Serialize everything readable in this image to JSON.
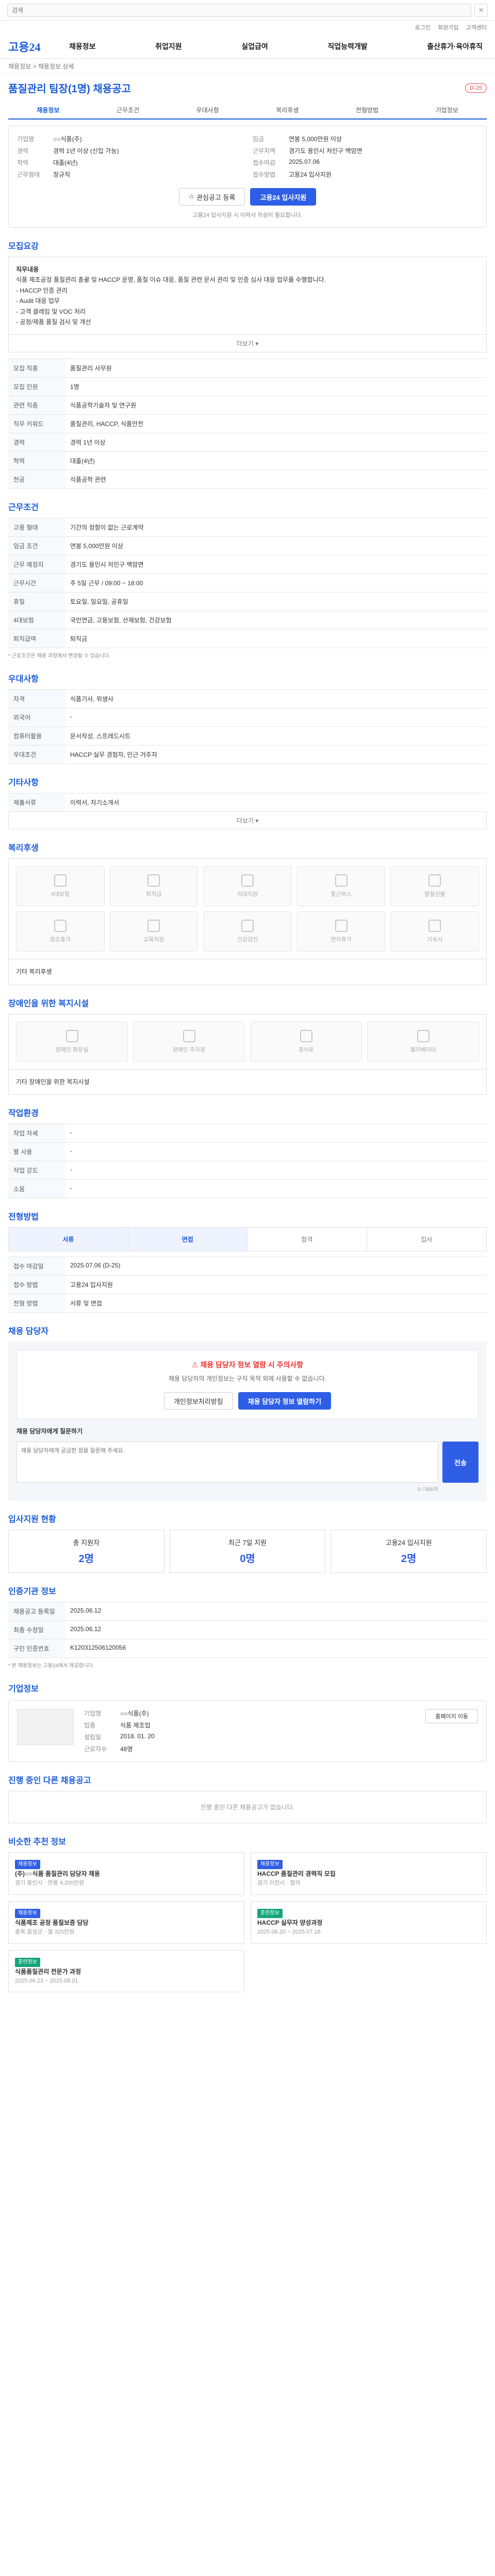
{
  "topbar": {
    "search_placeholder": "검색",
    "close_label": "✕"
  },
  "util": [
    "로그인",
    "회원가입",
    "고객센터"
  ],
  "logo": "고용24",
  "gnb": [
    "채용정보",
    "취업지원",
    "실업급여",
    "직업능력개발",
    "출산휴가·육아휴직"
  ],
  "breadcrumb": "채용정보 > 채용정보 상세",
  "title": {
    "text": "품질관리 팀장(1명) 채용공고",
    "pill": "D-25"
  },
  "tabs": [
    "채용정보",
    "근무조건",
    "우대사항",
    "복리후생",
    "전형방법",
    "기업정보"
  ],
  "summary": {
    "company_label": "기업명",
    "company": "○○식품(주)",
    "career_label": "경력",
    "career": "경력 1년 이상 (신입 가능)",
    "edu_label": "학력",
    "edu": "대졸(4년)",
    "type_label": "근무형태",
    "type": "정규직",
    "salary_label": "임금",
    "salary": "연봉 5,000만원 이상",
    "place_label": "근무지역",
    "place": "경기도 용인시 처인구 백암면",
    "apply_label": "접수마감",
    "apply": "2025.07.06",
    "method_label": "접수방법",
    "method": "고용24 입사지원",
    "bookmark_btn": "관심공고 등록",
    "apply_btn": "고용24 입사지원",
    "note": "고용24 입사지원 시 이력서 작성이 필요합니다."
  },
  "job": {
    "heading": "모집요강",
    "desc_title": "직무내용",
    "desc": "식품 제조공정 품질관리 총괄 및 HACCP 운영, 품질 이슈 대응, 품질 관련 문서 관리 및 인증 심사 대응 업무를 수행합니다.",
    "duty_lines": [
      "- HACCP 인증 관리",
      "- Audit 대응 업무",
      "- 고객 클레임 및 VOC 처리",
      "- 공정/제품 품질 검사 및 개선"
    ],
    "more": "더보기 ▾",
    "rows": [
      {
        "k": "모집 직종",
        "v": "품질관리 사무원"
      },
      {
        "k": "모집 인원",
        "v": "1명"
      },
      {
        "k": "관련 직종",
        "v": "식품공학기술자 및 연구원"
      },
      {
        "k": "직무 키워드",
        "v": "품질관리, HACCP, 식품안전"
      },
      {
        "k": "경력",
        "v": "경력 1년 이상"
      },
      {
        "k": "학력",
        "v": "대졸(4년)"
      },
      {
        "k": "전공",
        "v": "식품공학 관련"
      }
    ]
  },
  "work": {
    "heading": "근무조건",
    "rows": [
      {
        "k": "고용 형태",
        "v": "기간의 정함이 없는 근로계약"
      },
      {
        "k": "임금 조건",
        "v": "연봉 5,000만원 이상"
      },
      {
        "k": "근무 예정지",
        "v": "경기도 용인시 처인구 백암면"
      },
      {
        "k": "근무시간",
        "v": "주 5일 근무 / 09:00 ~ 18:00"
      },
      {
        "k": "휴일",
        "v": "토요일, 일요일, 공휴일"
      },
      {
        "k": "4대보험",
        "v": "국민연금, 고용보험, 산재보험, 건강보험"
      },
      {
        "k": "퇴직급여",
        "v": "퇴직금"
      }
    ],
    "note": "* 근로조건은 채용 과정에서 변경될 수 있습니다."
  },
  "pref": {
    "heading": "우대사항",
    "rows": [
      {
        "k": "자격",
        "v": "식품기사, 위생사"
      },
      {
        "k": "외국어",
        "v": "-"
      },
      {
        "k": "컴퓨터활용",
        "v": "문서작성, 스프레드시트"
      },
      {
        "k": "우대조건",
        "v": "HACCP 실무 경험자, 인근 거주자"
      }
    ]
  },
  "other": {
    "heading": "기타사항",
    "rows": [
      {
        "k": "제출서류",
        "v": "이력서, 자기소개서"
      }
    ],
    "more": "더보기 ▾"
  },
  "benefits": {
    "heading": "복리후생",
    "items": [
      "4대보험",
      "퇴직금",
      "식대지원",
      "통근버스",
      "명절선물",
      "경조휴가",
      "교육지원",
      "건강검진",
      "연차휴가",
      "기숙사"
    ],
    "more_label": "기타 복리후생"
  },
  "disability": {
    "heading": "장애인을 위한 복지시설",
    "items": [
      "장애인 화장실",
      "장애인 주차장",
      "경사로",
      "엘리베이터"
    ],
    "more_label": "기타 장애인을 위한 복지시설"
  },
  "workenv": {
    "heading": "작업환경",
    "rows": [
      {
        "k": "작업 자세",
        "v": "-"
      },
      {
        "k": "팔 사용",
        "v": "-"
      },
      {
        "k": "작업 강도",
        "v": "-"
      },
      {
        "k": "소음",
        "v": "-"
      }
    ]
  },
  "hiring": {
    "heading": "전형방법",
    "steps": [
      "서류",
      "면접",
      "합격",
      "입사"
    ],
    "rows": [
      {
        "k": "접수 마감일",
        "v": "2025.07.06 (D-25)"
      },
      {
        "k": "접수 방법",
        "v": "고용24 입사지원"
      },
      {
        "k": "전형 방법",
        "v": "서류 및 면접"
      }
    ]
  },
  "contact": {
    "heading": "채용 담당자",
    "alert_title": "채용 담당자 정보 열람 시 주의사항",
    "alert_text": "채용 담당자의 개인정보는 구직 목적 외에 사용할 수 없습니다.",
    "agree_btn": "개인정보처리방침",
    "view_btn": "채용 담당자 정보 열람하기",
    "q_label": "채용 담당자에게 질문하기",
    "q_placeholder": "채용 담당자에게 궁금한 점을 질문해 주세요.",
    "q_counter": "0 / 500자",
    "send": "전송"
  },
  "applicants": {
    "heading": "입사지원 현황",
    "stats": [
      {
        "k": "총 지원자",
        "v": "2명"
      },
      {
        "k": "최근 7일 지원",
        "v": "0명"
      },
      {
        "k": "고용24 입사지원",
        "v": "2명"
      }
    ]
  },
  "info": {
    "heading": "인증기관 정보",
    "rows": [
      {
        "k": "채용공고 등록일",
        "v": "2025.06.12"
      },
      {
        "k": "최종 수정일",
        "v": "2025.06.12"
      },
      {
        "k": "구인 인증번호",
        "v": "K120312506120056"
      }
    ],
    "footnote": "* 본 채용정보는 고용24에서 제공합니다."
  },
  "company": {
    "heading": "기업정보",
    "rows": [
      {
        "k": "기업명",
        "v": "○○식품(주)"
      },
      {
        "k": "업종",
        "v": "식품 제조업"
      },
      {
        "k": "설립일",
        "v": "2018. 01. 20"
      },
      {
        "k": "근로자수",
        "v": "48명"
      }
    ],
    "site_btn": "홈페이지 이동"
  },
  "ongoing": {
    "heading": "진행 중인 다른 채용공고",
    "empty": "진행 중인 다른 채용공고가 없습니다."
  },
  "recommend": {
    "heading": "비슷한 추천 정보",
    "items": [
      {
        "badge": "채용정보",
        "title": "(주)○○식품 품질관리 담당자 채용",
        "meta": "경기 용인시 · 연봉 4,200만원"
      },
      {
        "badge": "채용정보",
        "title": "HACCP 품질관리 경력직 모집",
        "meta": "경기 이천시 · 협의"
      },
      {
        "badge": "채용정보",
        "title": "식품제조 공정 품질보증 담당",
        "meta": "충북 음성군 · 월 320만원"
      },
      {
        "badge": "훈련정보",
        "title": "HACCP 실무자 양성과정",
        "meta": "2025.06.20 ~ 2025.07.18"
      },
      {
        "badge": "훈련정보",
        "title": "식품품질관리 전문가 과정",
        "meta": "2025.06.23 ~ 2025.08.01"
      }
    ]
  }
}
